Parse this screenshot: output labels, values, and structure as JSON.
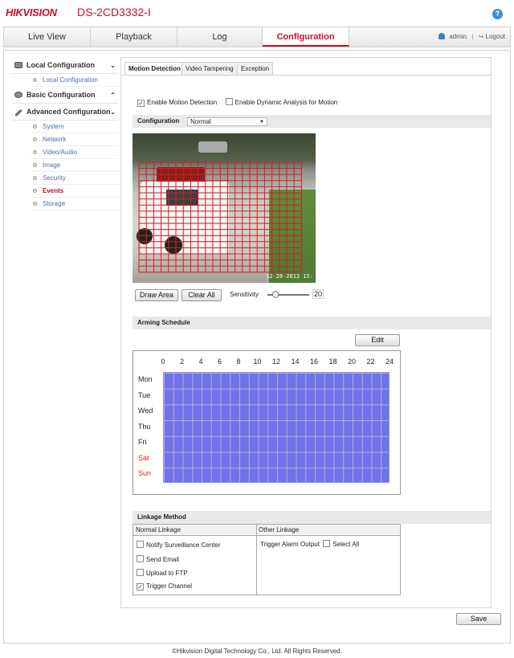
{
  "header": {
    "brand": "HIKVISION",
    "model": "DS-2CD3332-I",
    "help_glyph": "?"
  },
  "nav": {
    "tabs": [
      {
        "label": "Live View"
      },
      {
        "label": "Playback"
      },
      {
        "label": "Log"
      },
      {
        "label": "Configuration",
        "active": true
      }
    ],
    "user": "admin",
    "separator": "|",
    "logout": "Logout"
  },
  "sidebar": {
    "local": {
      "label": "Local Configuration",
      "items": [
        "Local Configuration"
      ]
    },
    "basic": {
      "label": "Basic Configuration"
    },
    "advanced": {
      "label": "Advanced Configuration",
      "items": [
        "System",
        "Network",
        "Video/Audio",
        "Image",
        "Security",
        "Events",
        "Storage"
      ],
      "active": "Events"
    }
  },
  "tabs": [
    "Motion Detection",
    "Video Tampering",
    "Exception"
  ],
  "motion": {
    "enable_label": "Enable Motion Detection",
    "enable_checked": true,
    "dynamic_label": "Enable Dynamic Analysis for Motion",
    "dynamic_checked": false,
    "config_label": "Configuration",
    "config_value": "Normal",
    "timestamp": "12-28-2013 15:",
    "draw_area": "Draw Area",
    "clear_all": "Clear All",
    "sensitivity_label": "Sensitivity",
    "sensitivity_value": "20"
  },
  "schedule": {
    "title": "Arming Schedule",
    "edit": "Edit",
    "hours": [
      "0",
      "2",
      "4",
      "6",
      "8",
      "10",
      "12",
      "14",
      "16",
      "18",
      "20",
      "22",
      "24"
    ],
    "days": [
      "Mon",
      "Tue",
      "Wed",
      "Thu",
      "Fri",
      "Sat",
      "Sun"
    ],
    "colors": {
      "armed": "#6f72e8",
      "weekend": "#d1281e"
    }
  },
  "linkage": {
    "title": "Linkage Method",
    "normal_header": "Normal Linkage",
    "other_header": "Other Linkage",
    "normal_items": [
      {
        "label": "Notify Surveillance Center",
        "checked": false
      },
      {
        "label": "Send Email",
        "checked": false
      },
      {
        "label": "Upload to FTP",
        "checked": false
      },
      {
        "label": "Trigger Channel",
        "checked": true
      }
    ],
    "trigger_alarm_output": "Trigger Alarm Output",
    "select_all": "Select All"
  },
  "save": "Save",
  "footer": "©Hikvision Digital Technology Co., Ltd. All Rights Reserved.",
  "accent_color": "#c8102e"
}
